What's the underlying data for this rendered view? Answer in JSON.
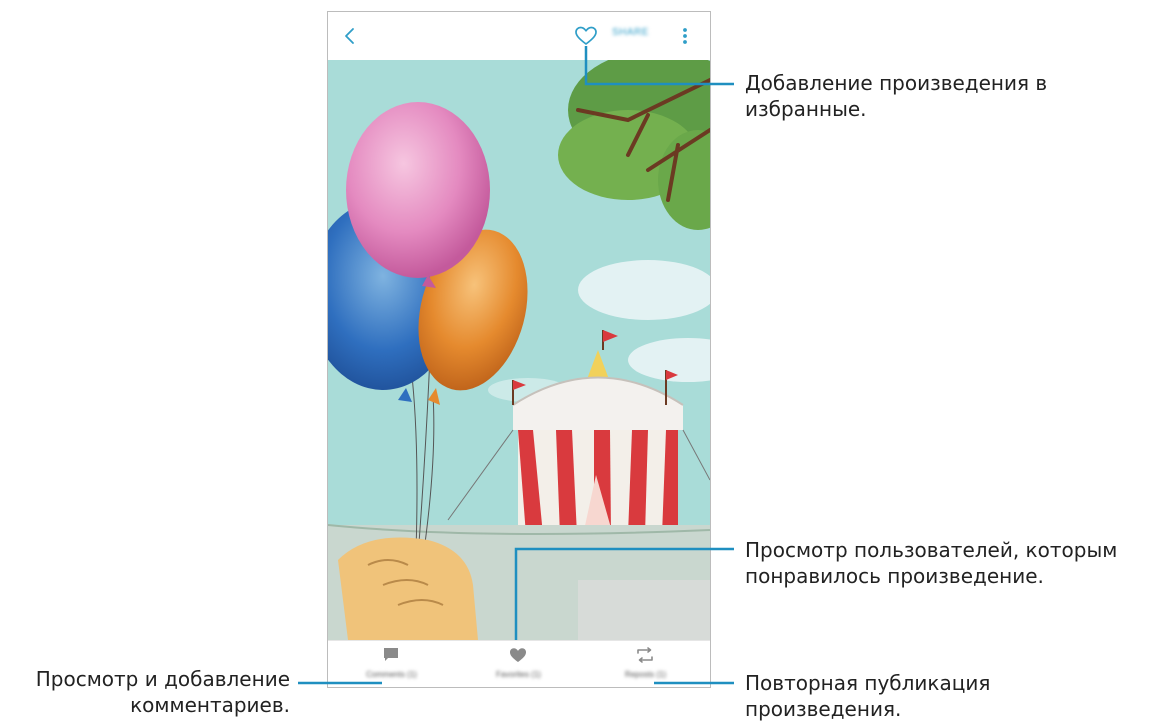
{
  "toolbar": {
    "back_icon": "chevron-left-icon",
    "favorite_icon": "heart-outline-icon",
    "share_label": "SHARE",
    "more_icon": "more-vert-icon"
  },
  "tabs": [
    {
      "label": "Comments (1)",
      "icon": "comment-icon"
    },
    {
      "label": "Favorites (1)",
      "icon": "heart-icon"
    },
    {
      "label": "Reposts (1)",
      "icon": "repost-icon"
    }
  ],
  "callouts": {
    "favorite": "Добавление произведения в избранные.",
    "likes": "Просмотр пользователей, которым понравилось произведение.",
    "comments": "Просмотр и добавление комментариев.",
    "repost": "Повторная публикация произведения."
  },
  "colors": {
    "accent": "#2f9ec8",
    "callout_line": "#1f8fc0"
  }
}
